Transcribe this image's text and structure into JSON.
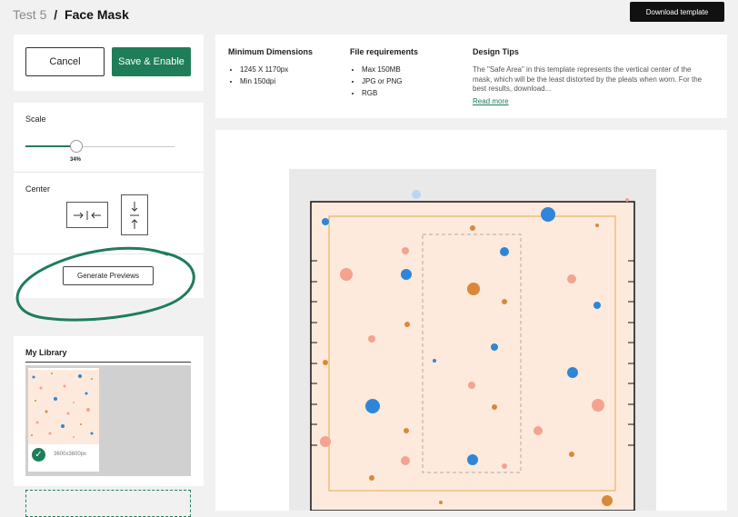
{
  "breadcrumb": {
    "parent": "Test 5",
    "separator": "/",
    "current": "Face Mask"
  },
  "header": {
    "download_label": "Download template"
  },
  "actions": {
    "cancel_label": "Cancel",
    "save_label": "Save & Enable"
  },
  "scale": {
    "label": "Scale",
    "value_text": "34%",
    "value": 0.34
  },
  "center": {
    "label": "Center",
    "horizontal_icon": "arrows-horizontal-center-icon",
    "vertical_icon": "arrows-vertical-center-icon"
  },
  "generate": {
    "label": "Generate Previews"
  },
  "info": {
    "min_dimensions": {
      "title": "Minimum Dimensions",
      "items": [
        "1245 X 1170px",
        "Min 150dpi"
      ]
    },
    "file_requirements": {
      "title": "File requirements",
      "items": [
        "Max 150MB",
        "JPG or PNG",
        "RGB"
      ]
    },
    "design_tips": {
      "title": "Design Tips",
      "text": "The \"Safe Area\" in this template represents the vertical center of the mask, which will be the least distorted by the pleats when worn. For the best results, download...",
      "read_more": "Read more"
    }
  },
  "library": {
    "title": "My Library",
    "item_size": "3600x3600px"
  },
  "colors": {
    "accent": "#1f7d5a",
    "mask_bg": "#fdeadc",
    "dot_blue": "#2f86d8",
    "dot_orange": "#d9893a",
    "dot_salmon": "#f3a38f",
    "safe_border": "#e8a84a"
  }
}
